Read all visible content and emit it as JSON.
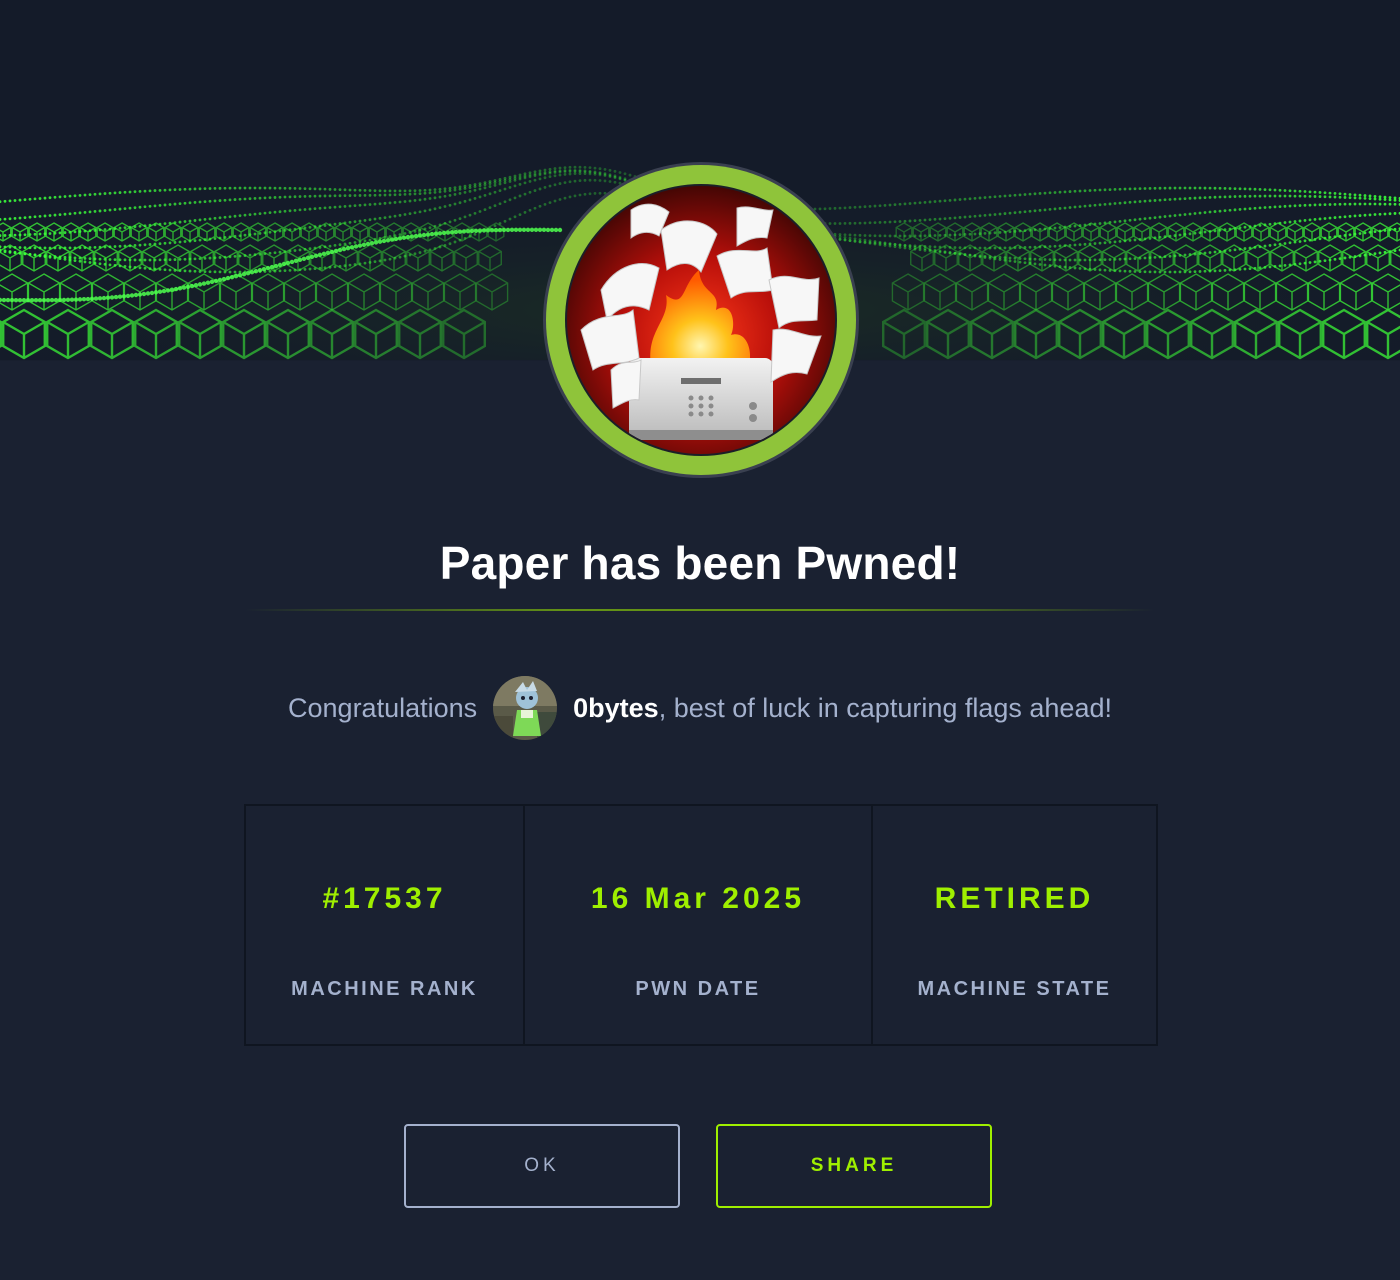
{
  "title": "Paper has been Pwned!",
  "congrats": {
    "prefix": "Congratulations",
    "username": "0bytes",
    "suffix": ", best of luck in capturing flags ahead!"
  },
  "stats": [
    {
      "value": "#17537",
      "label": "MACHINE RANK"
    },
    {
      "value": "16 Mar 2025",
      "label": "PWN DATE"
    },
    {
      "value": "RETIRED",
      "label": "MACHINE STATE"
    }
  ],
  "buttons": {
    "ok": "OK",
    "share": "SHARE"
  },
  "colors": {
    "background": "#1a2131",
    "accent": "#9fef00",
    "muted_text": "#a4b1cd",
    "emblem_ring": "#8fc43a"
  },
  "icons": {
    "machine_avatar": "burning-printer-icon",
    "user_avatar": "user-avatar-icon"
  }
}
